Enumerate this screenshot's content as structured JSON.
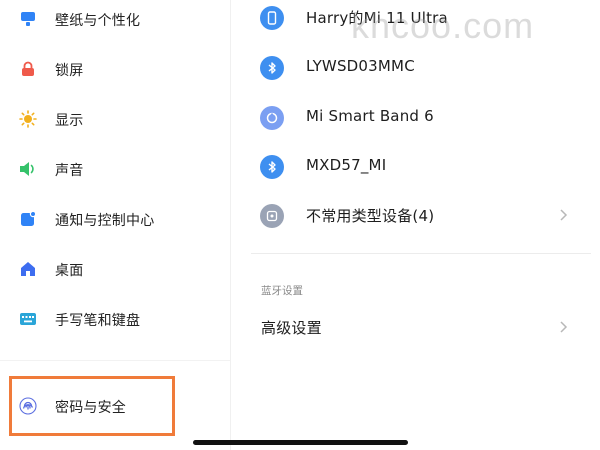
{
  "sidebar": {
    "items": [
      {
        "label": "壁纸与个性化",
        "icon": "wallpaper-icon",
        "color": "#2f83f6"
      },
      {
        "label": "锁屏",
        "icon": "lock-icon",
        "color": "#ef5a4b"
      },
      {
        "label": "显示",
        "icon": "sun-icon",
        "color": "#f2b01e"
      },
      {
        "label": "声音",
        "icon": "speaker-icon",
        "color": "#35c26a"
      },
      {
        "label": "通知与控制中心",
        "icon": "notification-icon",
        "color": "#2f83f6"
      },
      {
        "label": "桌面",
        "icon": "home-icon",
        "color": "#3d6df0"
      },
      {
        "label": "手写笔和键盘",
        "icon": "keyboard-icon",
        "color": "#2aa5d8"
      },
      {
        "label": "密码与安全",
        "icon": "fingerprint-icon",
        "color": "#5b6ee0"
      }
    ],
    "highlight_color": "#f07b3a"
  },
  "devices": {
    "items": [
      {
        "label": "Harry的Mi 11 Ultra",
        "icon": "phone-icon"
      },
      {
        "label": "LYWSD03MMC",
        "icon": "bluetooth-icon"
      },
      {
        "label": "Mi Smart Band 6",
        "icon": "band-icon"
      },
      {
        "label": "MXD57_MI",
        "icon": "bluetooth-icon"
      },
      {
        "label": "不常用类型设备(4)",
        "icon": "device-icon"
      }
    ],
    "section_label": "蓝牙设置",
    "advanced_label": "高级设置",
    "bluetooth_color": "#3e8ff0"
  },
  "watermark": "khcoo.com"
}
